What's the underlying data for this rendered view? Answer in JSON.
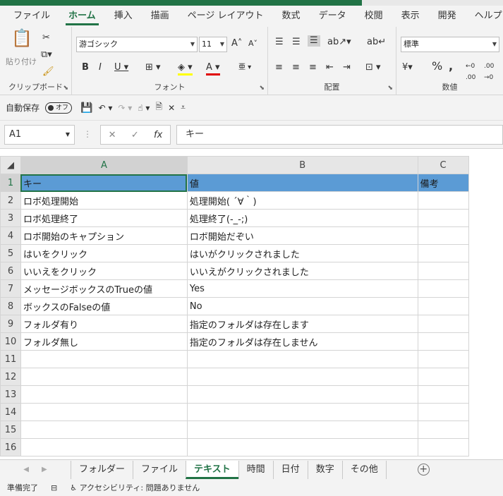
{
  "ribbon_tabs": [
    "ファイル",
    "ホーム",
    "挿入",
    "描画",
    "ページ レイアウト",
    "数式",
    "データ",
    "校閲",
    "表示",
    "開発",
    "ヘルプ"
  ],
  "ribbon": {
    "clipboard": {
      "label": "クリップボード",
      "paste": "貼り付け"
    },
    "font": {
      "label": "フォント",
      "font_name": "游ゴシック",
      "font_size": "11"
    },
    "alignment": {
      "label": "配置"
    },
    "number": {
      "label": "数値",
      "format": "標準"
    }
  },
  "qat": {
    "autosave_label": "自動保存",
    "autosave_state": "オフ"
  },
  "formula_bar": {
    "name_box": "A1",
    "formula": "キー"
  },
  "columns": [
    "A",
    "B",
    "C"
  ],
  "rows": [
    {
      "n": "1",
      "a": "キー",
      "b": "値",
      "c": "備考"
    },
    {
      "n": "2",
      "a": "ロボ処理開始",
      "b": "処理開始( ´∀｀)",
      "c": ""
    },
    {
      "n": "3",
      "a": "ロボ処理終了",
      "b": "処理終了(-_-;)",
      "c": ""
    },
    {
      "n": "4",
      "a": "ロボ開始のキャプション",
      "b": "ロボ開始だぞい",
      "c": ""
    },
    {
      "n": "5",
      "a": "はいをクリック",
      "b": "はいがクリックされました",
      "c": ""
    },
    {
      "n": "6",
      "a": "いいえをクリック",
      "b": "いいえがクリックされました",
      "c": ""
    },
    {
      "n": "7",
      "a": "メッセージボックスのTrueの値",
      "b": "Yes",
      "c": ""
    },
    {
      "n": "8",
      "a": "ボックスのFalseの値",
      "b": "No",
      "c": ""
    },
    {
      "n": "9",
      "a": "フォルダ有り",
      "b": "指定のフォルダは存在します",
      "c": ""
    },
    {
      "n": "10",
      "a": "フォルダ無し",
      "b": "指定のフォルダは存在しません",
      "c": ""
    },
    {
      "n": "11",
      "a": "",
      "b": "",
      "c": ""
    },
    {
      "n": "12",
      "a": "",
      "b": "",
      "c": ""
    },
    {
      "n": "13",
      "a": "",
      "b": "",
      "c": ""
    },
    {
      "n": "14",
      "a": "",
      "b": "",
      "c": ""
    },
    {
      "n": "15",
      "a": "",
      "b": "",
      "c": ""
    },
    {
      "n": "16",
      "a": "",
      "b": "",
      "c": ""
    }
  ],
  "sheets": [
    "フォルダー",
    "ファイル",
    "テキスト",
    "時間",
    "日付",
    "数字",
    "その他"
  ],
  "active_sheet": "テキスト",
  "status": {
    "ready": "準備完了",
    "accessibility": "アクセシビリティ: 問題ありません"
  },
  "colors": {
    "accent": "#217346",
    "header_fill": "#5b9bd5"
  }
}
